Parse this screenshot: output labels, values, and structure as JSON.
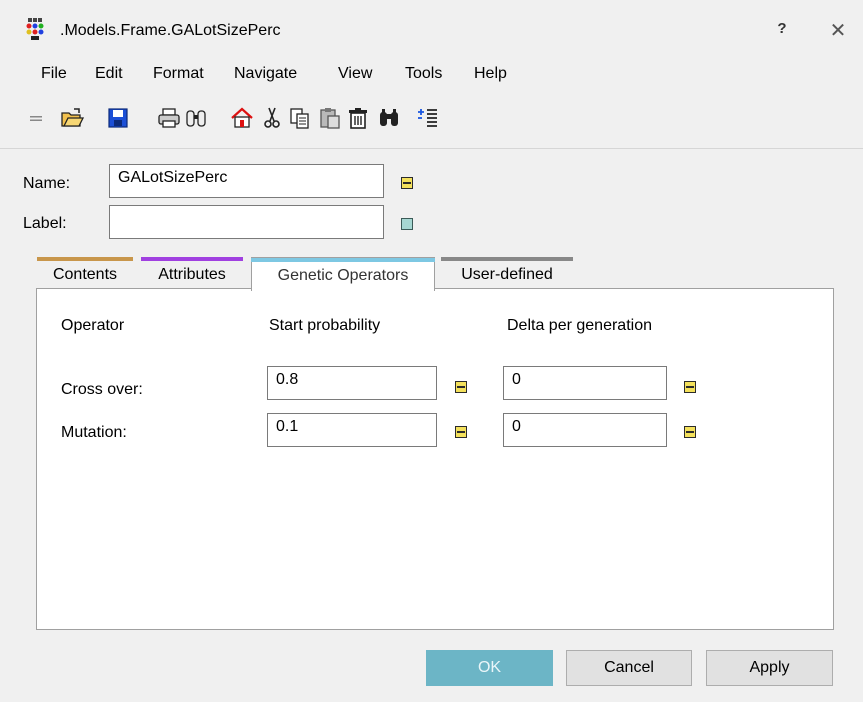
{
  "window": {
    "title": ".Models.Frame.GALotSizePerc",
    "help_label": "?",
    "close_label": "✕"
  },
  "menu": [
    "File",
    "Edit",
    "Format",
    "Navigate",
    "View",
    "Tools",
    "Help"
  ],
  "toolbar": {
    "icons": [
      "drag-grip-icon",
      "open-folder-icon",
      "save-icon",
      "print-icon",
      "binoculars-preview-icon",
      "home-icon",
      "cut-icon",
      "copy-icon",
      "paste-icon",
      "delete-icon",
      "find-icon",
      "insert-icon"
    ]
  },
  "form": {
    "name_label": "Name:",
    "name_value": "GALotSizePerc",
    "label_label": "Label:",
    "label_value": ""
  },
  "tabs": [
    {
      "label": "Contents",
      "color": "#c8964b",
      "active": false
    },
    {
      "label": "Attributes",
      "color": "#a040e0",
      "active": false
    },
    {
      "label": "Genetic Operators",
      "color": "#7ec8e3",
      "active": true
    },
    {
      "label": "User-defined",
      "color": "#888888",
      "active": false
    }
  ],
  "operators": {
    "headers": {
      "operator": "Operator",
      "start": "Start probability",
      "delta": "Delta per generation"
    },
    "rows": [
      {
        "label": "Cross over:",
        "start": "0.8",
        "delta": "0"
      },
      {
        "label": "Mutation:",
        "start": "0.1",
        "delta": "0"
      }
    ]
  },
  "buttons": {
    "ok": "OK",
    "cancel": "Cancel",
    "apply": "Apply"
  },
  "colors": {
    "accent": "#6cb5c6",
    "inherit_marker": "#f4e15c",
    "local_marker": "#a6d7d2"
  }
}
